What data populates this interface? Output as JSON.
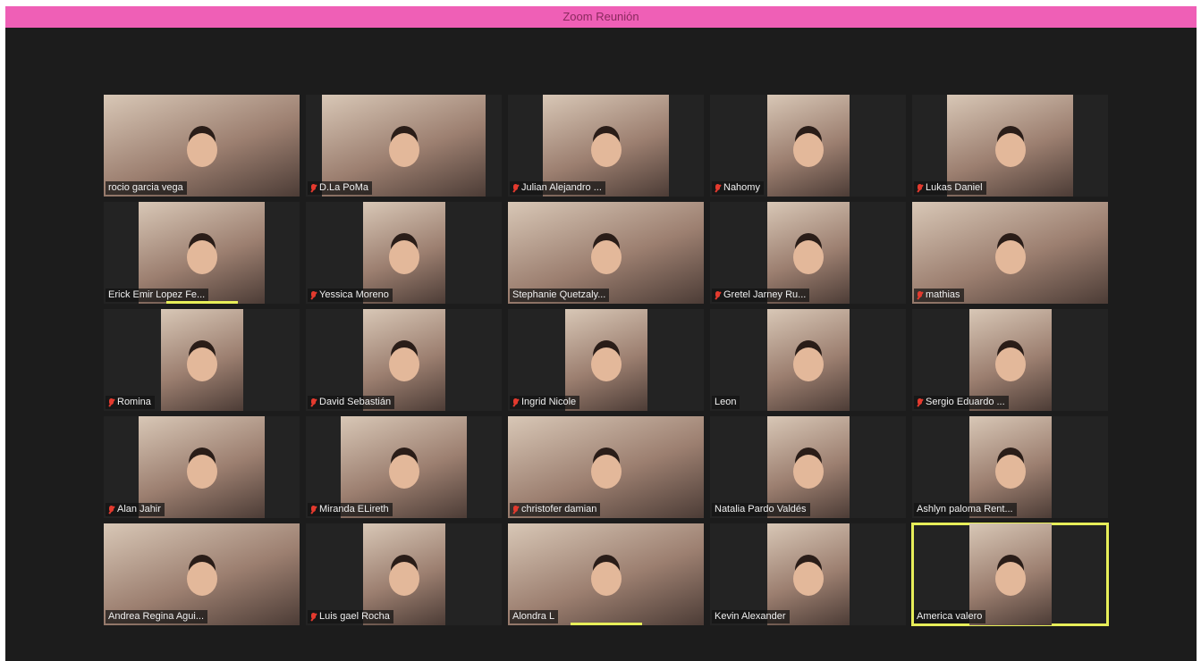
{
  "window": {
    "title": "Zoom Reunión"
  },
  "participants": [
    {
      "name": "rocio garcia vega",
      "muted": false
    },
    {
      "name": "D.La PoMa",
      "muted": true
    },
    {
      "name": "Julian Alejandro ...",
      "muted": true
    },
    {
      "name": "Nahomy",
      "muted": true
    },
    {
      "name": "Lukas Daniel",
      "muted": true
    },
    {
      "name": "Erick Emir Lopez Fe...",
      "muted": false
    },
    {
      "name": "Yessica Moreno",
      "muted": true
    },
    {
      "name": "Stephanie Quetzaly...",
      "muted": false
    },
    {
      "name": "Gretel Jarney Ru...",
      "muted": true
    },
    {
      "name": "mathias",
      "muted": true
    },
    {
      "name": "Romina",
      "muted": true
    },
    {
      "name": "David Sebastián",
      "muted": true
    },
    {
      "name": "Ingrid Nicole",
      "muted": true
    },
    {
      "name": "Leon",
      "muted": false
    },
    {
      "name": "Sergio Eduardo ...",
      "muted": true
    },
    {
      "name": "Alan Jahir",
      "muted": true
    },
    {
      "name": "Miranda ELireth",
      "muted": true
    },
    {
      "name": "christofer damian",
      "muted": true
    },
    {
      "name": "Natalia Pardo Valdés",
      "muted": false
    },
    {
      "name": "Ashlyn paloma Rent...",
      "muted": false
    },
    {
      "name": "Andrea Regina Agui...",
      "muted": false
    },
    {
      "name": "Luis gael Rocha",
      "muted": true
    },
    {
      "name": "Alondra L",
      "muted": false
    },
    {
      "name": "Kevin Alexander",
      "muted": false
    },
    {
      "name": "America valero",
      "muted": false
    }
  ],
  "icons": {
    "muted": "mic-muted-icon"
  },
  "colors": {
    "titlebar": "#ef5fb6",
    "active_speaker": "#e7ee59",
    "muted_icon": "#e33a2e"
  }
}
